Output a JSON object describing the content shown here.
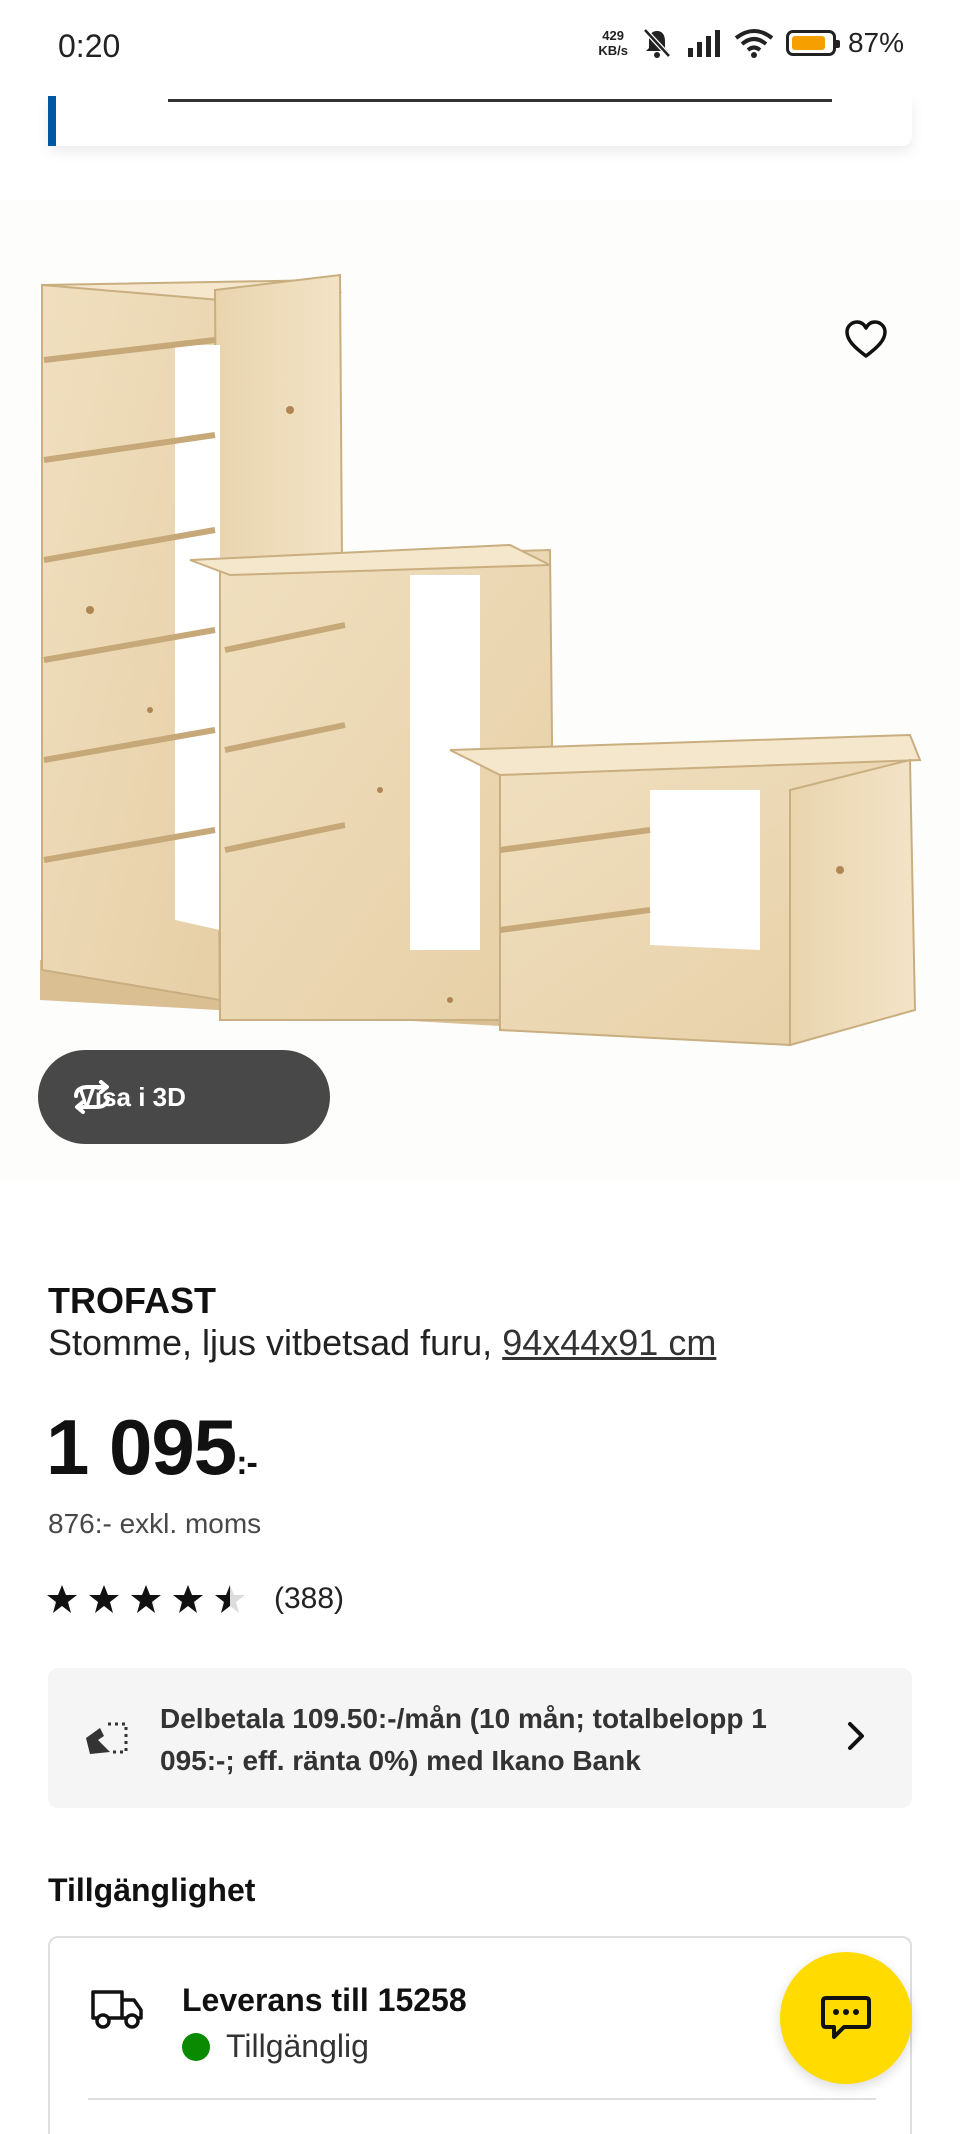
{
  "status_bar": {
    "time": "0:20",
    "net_speed_value": "429",
    "net_speed_unit": "KB/s",
    "battery_percent": "87%",
    "battery_level": 0.87,
    "icons": [
      "mute-bell-icon",
      "signal-icon",
      "wifi-icon",
      "battery-icon"
    ]
  },
  "product": {
    "name": "TROFAST",
    "description": "Stomme, ljus vitbetsad furu,",
    "dimensions": "94x44x91 cm",
    "price_main": "1 095",
    "price_suffix": ":-",
    "price_excl": "876:- exkl. moms",
    "rating_value": 4.5,
    "rating_max": 5,
    "rating_count": "(388)",
    "view_3d_label": "Visa i 3D"
  },
  "finance": {
    "text": "Delbetala 109.50:-/mån (10 mån; totalbelopp 1 095:-; eff. ränta 0%) med Ikano Bank"
  },
  "availability": {
    "title": "Tillgänglighet",
    "delivery_title": "Leverans till 15258",
    "delivery_status": "Tillgänglig",
    "status_color": "#0a8a00"
  },
  "colors": {
    "accent_blue": "#0058a3",
    "ikea_yellow": "#ffdb00",
    "pill_dark": "#484848"
  }
}
